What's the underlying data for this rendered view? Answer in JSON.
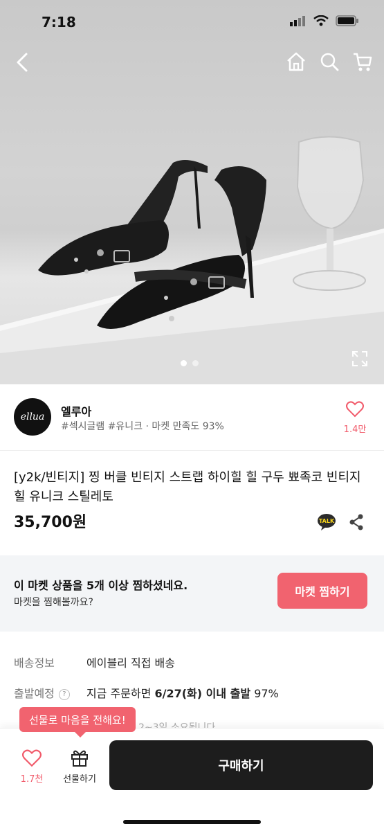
{
  "status_bar": {
    "time": "7:18"
  },
  "gallery": {
    "page_count": 2,
    "current_page": 1
  },
  "seller": {
    "logo_text": "ellua",
    "name": "엘루아",
    "tags": "#섹시글램 #유니크 · 마켓 만족도 93%",
    "like_count": "1.4만"
  },
  "product": {
    "title": "[y2k/빈티지] 찡 버클 빈티지 스트랩 하이힐 힐 구두 뾰족코 빈티지 힐 유니크 스틸레토",
    "price": "35,700원",
    "talk_label": "TALK"
  },
  "market_banner": {
    "line1": "이 마켓 상품을 5개 이상 찜하셨네요.",
    "line2": "마켓을 찜해볼까요?",
    "button_label": "마켓 찜하기"
  },
  "info": {
    "shipping_key": "배송정보",
    "shipping_value": "에이블리 직접 배송",
    "departure_key": "출발예정",
    "departure_help": "?",
    "departure_prefix": "지금 주문하면 ",
    "departure_date": "6/27(화) 이내 출발",
    "departure_suffix": " 97%",
    "partial_text": "2~3일 소요됩니다"
  },
  "bottom_bar": {
    "like_count": "1.7천",
    "gift_label": "선물하기",
    "buy_label": "구매하기",
    "tooltip": "선물로 마음을 전해요!"
  },
  "colors": {
    "accent": "#f15a6a",
    "dark_button": "#1d1d1d",
    "banner_bg": "#f3f5f7"
  }
}
